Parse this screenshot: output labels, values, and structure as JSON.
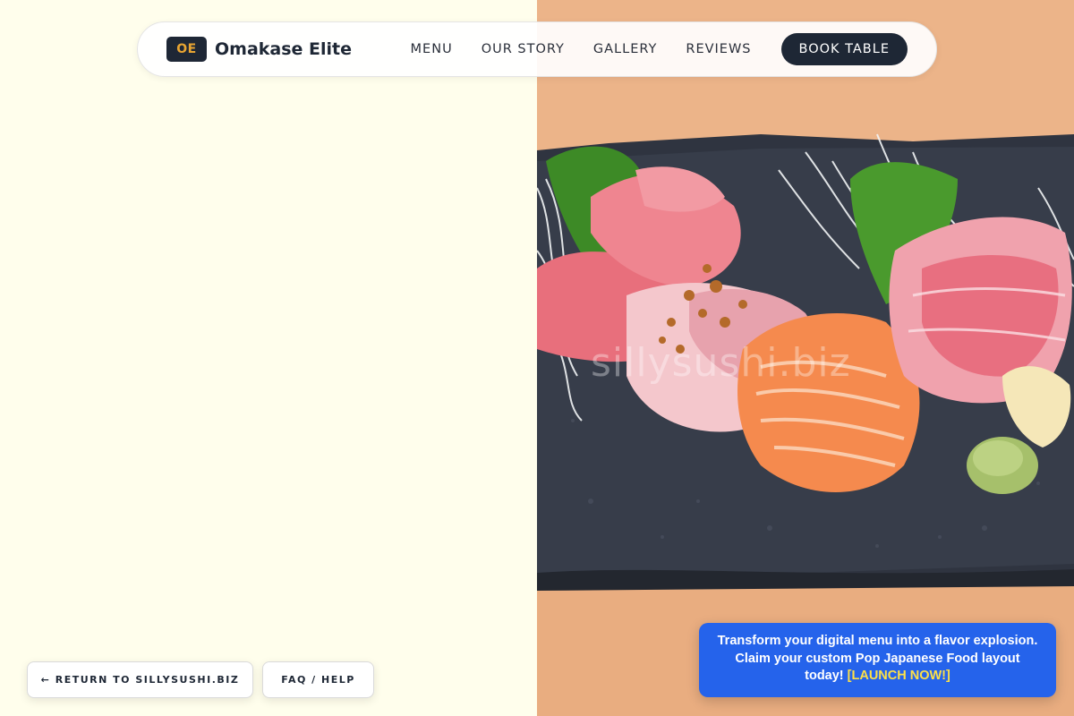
{
  "brand": {
    "badge": "OE",
    "name": "Omakase Elite",
    "badge_color": "#e8a532",
    "dark": "#1e2735"
  },
  "nav": {
    "links": [
      "MENU",
      "OUR STORY",
      "GALLERY",
      "REVIEWS"
    ],
    "cta": "BOOK TABLE"
  },
  "hero": {
    "watermark": "sillysushi.biz",
    "image_description_icon": "sashimi-photo"
  },
  "footer_buttons": {
    "return": "← RETURN TO SILLYSUSHI.BIZ",
    "faq": "FAQ / HELP"
  },
  "promo": {
    "text": "Transform your digital menu into a flavor explosion. Claim your custom Pop Japanese Food layout today!",
    "link": "[LAUNCH NOW!]",
    "bg_color": "#2563eb",
    "link_color": "#fde047"
  }
}
